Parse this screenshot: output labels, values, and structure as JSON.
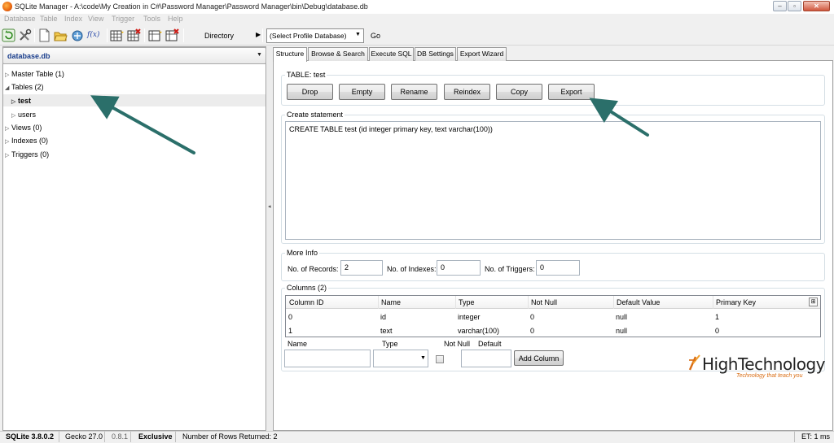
{
  "window": {
    "title": "SQLite Manager - A:\\code\\My Creation in C#\\Password Manager\\Password Manager\\bin\\Debug\\database.db",
    "minimize_label": "–",
    "maximize_label": "▫",
    "close_label": "✕"
  },
  "menu": [
    "Database",
    "Table",
    "Index",
    "View",
    "Trigger",
    "Tools",
    "Help"
  ],
  "toolbar": {
    "directory_label": "Directory",
    "directory_arrow": "▶",
    "profile_select_value": "(Select Profile Database)",
    "go_label": "Go",
    "function_icon_text": "f(x)"
  },
  "sidebar": {
    "database_select": "database.db",
    "tree": [
      {
        "label": "Master Table (1)",
        "expanded": false
      },
      {
        "label": "Tables (2)",
        "expanded": true
      },
      {
        "label": "test",
        "selected": true
      },
      {
        "label": "users"
      },
      {
        "label": "Views (0)"
      },
      {
        "label": "Indexes (0)"
      },
      {
        "label": "Triggers (0)"
      }
    ]
  },
  "tabs": [
    "Structure",
    "Browse & Search",
    "Execute SQL",
    "DB Settings",
    "Export Wizard"
  ],
  "active_tab": "Structure",
  "structure": {
    "table_group_label": "TABLE: test",
    "buttons": [
      "Drop",
      "Empty",
      "Rename",
      "Reindex",
      "Copy",
      "Export"
    ],
    "create_group_label": "Create statement",
    "create_statement": "CREATE TABLE test (id integer primary key, text varchar(100))",
    "more_info_label": "More Info",
    "records_label": "No. of Records:",
    "records_value": "2",
    "indexes_label": "No. of Indexes:",
    "indexes_value": "0",
    "triggers_label": "No. of Triggers:",
    "triggers_value": "0",
    "columns_group_label": "Columns (2)",
    "columns_headers": [
      "Column ID",
      "Name",
      "Type",
      "Not Null",
      "Default Value",
      "Primary Key"
    ],
    "columns_rows": [
      [
        "0",
        "id",
        "integer",
        "0",
        "null",
        "1"
      ],
      [
        "1",
        "text",
        "varchar(100)",
        "0",
        "null",
        "0"
      ]
    ],
    "new_column": {
      "name_label": "Name",
      "type_label": "Type",
      "notnull_label": "Not Null",
      "default_label": "Default",
      "add_button": "Add Column"
    }
  },
  "logo": {
    "text": "HighTechnology",
    "tagline": "Technology that teach you"
  },
  "status": {
    "sqlite": "SQLite 3.8.0.2",
    "gecko": "Gecko 27.0",
    "version": "0.8.1",
    "mode": "Exclusive",
    "rows": "Number of Rows Returned: 2",
    "et": "ET: 1 ms"
  },
  "colors": {
    "accent": "#1a3e8c",
    "annotation_arrow": "#2b6f6a",
    "logo_orange": "#d96d14"
  }
}
